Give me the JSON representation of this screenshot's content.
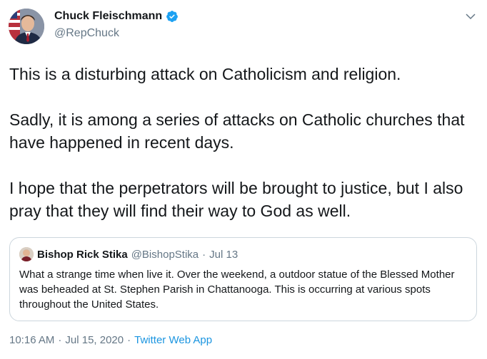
{
  "author": {
    "display_name": "Chuck Fleischmann",
    "handle": "@RepChuck",
    "verified": true,
    "avatar_icon": "profile-photo"
  },
  "tweet": {
    "paragraphs": [
      "This is a disturbing attack on Catholicism and religion.",
      "Sadly, it is among a series of attacks on Catholic churches that have happened in recent days.",
      "I hope that the perpetrators will be brought to justice, but I also pray that they will find their way to God as well."
    ]
  },
  "quoted_tweet": {
    "display_name": "Bishop Rick Stika",
    "handle": "@BishopStika",
    "separator": "·",
    "date": "Jul 13",
    "text": "What a strange time when live it. Over the weekend, a outdoor statue of the Blessed Mother was beheaded at St. Stephen Parish in Chattanooga. This is occurring at various spots throughout the United States."
  },
  "meta": {
    "time": "10:16 AM",
    "date": "Jul 15, 2020",
    "separator": "·",
    "source": "Twitter Web App"
  },
  "colors": {
    "text": "#14171a",
    "secondary": "#657786",
    "link": "#1b95e0",
    "verified_badge": "#1da1f2",
    "border": "#ccd6dd"
  }
}
